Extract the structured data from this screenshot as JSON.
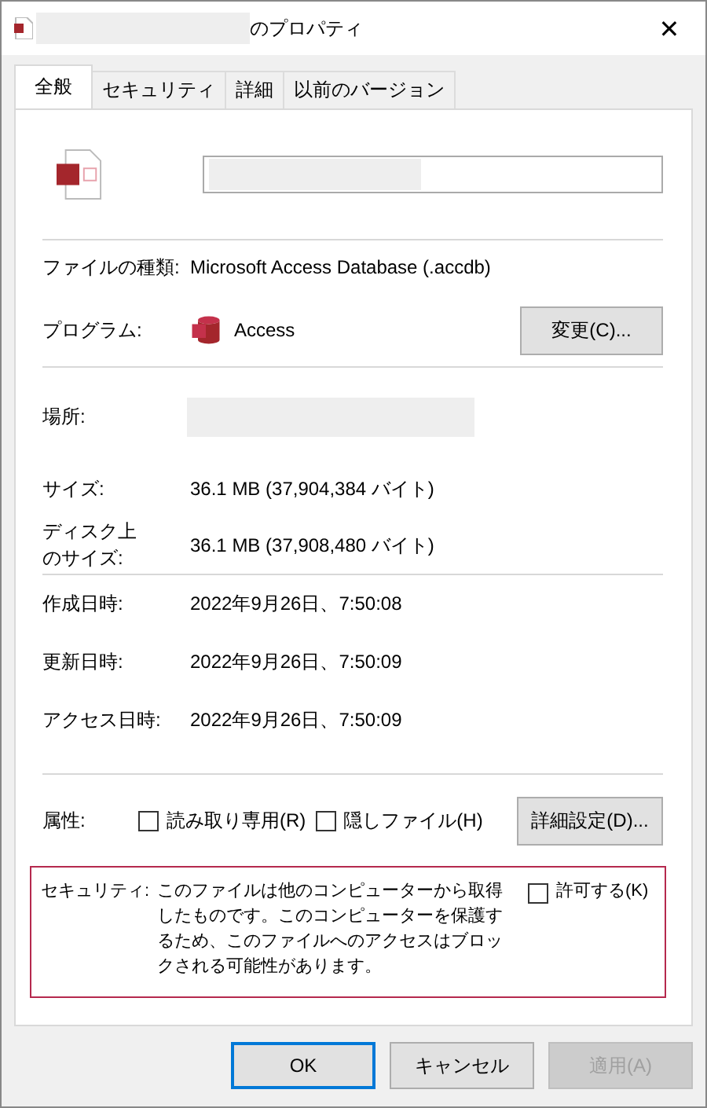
{
  "window": {
    "title": "のプロパティ",
    "close": "✕"
  },
  "tabs": [
    {
      "label": "全般",
      "selected": true
    },
    {
      "label": "セキュリティ",
      "selected": false
    },
    {
      "label": "詳細",
      "selected": false
    },
    {
      "label": "以前のバージョン",
      "selected": false
    }
  ],
  "type_row": {
    "label": "ファイルの種類:",
    "value": "Microsoft Access Database (.accdb)"
  },
  "program_row": {
    "label": "プログラム:",
    "value": "Access",
    "button": "変更(C)..."
  },
  "location_row": {
    "label": "場所:"
  },
  "size_rows": [
    {
      "label": "サイズ:",
      "value": "36.1 MB (37,904,384 バイト)"
    },
    {
      "label": "ディスク上のサイズ:",
      "value": "36.1 MB (37,908,480 バイト)"
    }
  ],
  "date_rows": [
    {
      "label": "作成日時:",
      "value": "2022年9月26日、7:50:08"
    },
    {
      "label": "更新日時:",
      "value": "2022年9月26日、7:50:09"
    },
    {
      "label": "アクセス日時:",
      "value": "2022年9月26日、7:50:09"
    }
  ],
  "attributes": {
    "label": "属性:",
    "options": [
      {
        "label": "読み取り専用(R)",
        "checked": false
      },
      {
        "label": "隠しファイル(H)",
        "checked": false
      }
    ],
    "button": "詳細設定(D)..."
  },
  "security": {
    "label": "セキュリティ:",
    "message": "このファイルは他のコンピューターから取得したものです。このコンピューターを保護するため、このファイルへのアクセスはブロックされる可能性があります。",
    "allow": {
      "label": "許可する(K)",
      "checked": false
    }
  },
  "buttons": [
    {
      "label": "OK",
      "disabled": false,
      "default": true
    },
    {
      "label": "キャンセル",
      "disabled": false,
      "default": false
    },
    {
      "label": "適用(A)",
      "disabled": true,
      "default": false
    }
  ]
}
